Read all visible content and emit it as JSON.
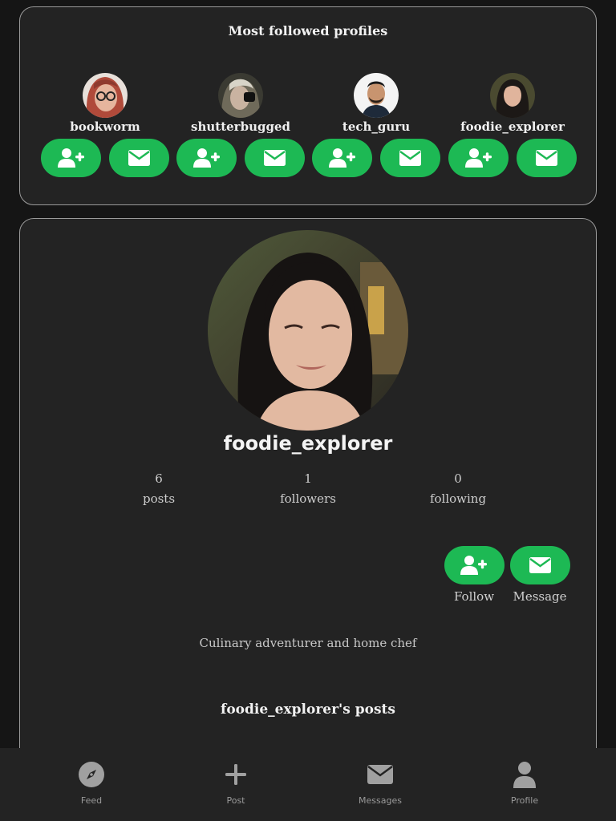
{
  "most_followed": {
    "title": "Most followed profiles",
    "profiles": [
      {
        "username": "bookworm",
        "avatar_icon": "avatar-photo"
      },
      {
        "username": "shutterbugged",
        "avatar_icon": "avatar-photo"
      },
      {
        "username": "tech_guru",
        "avatar_icon": "avatar-photo"
      },
      {
        "username": "foodie_explorer",
        "avatar_icon": "avatar-photo"
      }
    ]
  },
  "profile": {
    "username": "foodie_explorer",
    "stats": [
      {
        "value": "6",
        "label": "posts"
      },
      {
        "value": "1",
        "label": "followers"
      },
      {
        "value": "0",
        "label": "following"
      }
    ],
    "follow_label": "Follow",
    "message_label": "Message",
    "bio": "Culinary adventurer and home chef",
    "posts_title": "foodie_explorer's posts"
  },
  "nav": [
    {
      "label": "Feed",
      "icon": "compass-icon"
    },
    {
      "label": "Post",
      "icon": "plus-icon"
    },
    {
      "label": "Messages",
      "icon": "envelope-icon"
    },
    {
      "label": "Profile",
      "icon": "user-icon"
    }
  ],
  "colors": {
    "accent": "#1db954",
    "background": "#151515",
    "card": "#232323"
  }
}
